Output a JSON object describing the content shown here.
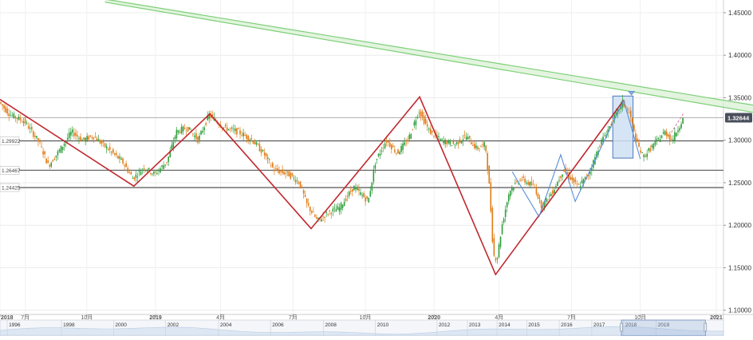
{
  "chart_data": {
    "type": "candlestick",
    "y_ticks": [
      "1.45000",
      "1.40000",
      "1.35000",
      "1.30000",
      "1.25000",
      "1.20000",
      "1.15000",
      "1.10000"
    ],
    "y_tick_values": [
      1.45,
      1.4,
      1.35,
      1.3,
      1.25,
      1.2,
      1.15,
      1.1
    ],
    "ylim": [
      1.095,
      1.465
    ],
    "x_ticks": [
      {
        "label": "2018",
        "t": 0
      },
      {
        "label": "7月",
        "t": 0.035
      },
      {
        "label": "10月",
        "t": 0.12
      },
      {
        "label": "2019",
        "t": 0.215
      },
      {
        "label": "4月",
        "t": 0.305
      },
      {
        "label": "7月",
        "t": 0.405
      },
      {
        "label": "10月",
        "t": 0.505
      },
      {
        "label": "2020",
        "t": 0.6
      },
      {
        "label": "4月",
        "t": 0.69
      },
      {
        "label": "7月",
        "t": 0.79
      },
      {
        "label": "10月",
        "t": 0.885
      },
      {
        "label": "2021",
        "t": 0.99
      }
    ],
    "current_price": {
      "label": "1.32644",
      "value": 1.32644
    },
    "horizontal_levels": [
      {
        "label": "",
        "value": 1.3264
      },
      {
        "label": "1.29922",
        "value": 1.2992
      },
      {
        "label": "1.26467",
        "value": 1.2647
      },
      {
        "label": "1.24425",
        "value": 1.2443
      }
    ],
    "resistance_channel": {
      "x0": 0.145,
      "y0_top": 1.466,
      "y0_bot": 1.4625,
      "x1": 1.0,
      "y1_top": 1.3395,
      "y1_bot": 1.331
    },
    "zigzag": [
      {
        "t": 0.0,
        "v": 1.348
      },
      {
        "t": 0.185,
        "v": 1.246
      },
      {
        "t": 0.29,
        "v": 1.331
      },
      {
        "t": 0.43,
        "v": 1.196
      },
      {
        "t": 0.58,
        "v": 1.351
      },
      {
        "t": 0.685,
        "v": 1.142
      },
      {
        "t": 0.862,
        "v": 1.347
      }
    ],
    "zigzag_blue": [
      {
        "t": 0.708,
        "v": 1.263
      },
      {
        "t": 0.745,
        "v": 1.21
      },
      {
        "t": 0.775,
        "v": 1.283
      },
      {
        "t": 0.795,
        "v": 1.228
      },
      {
        "t": 0.862,
        "v": 1.347
      },
      {
        "t": 0.885,
        "v": 1.278
      }
    ],
    "highlight_box": {
      "t0": 0.847,
      "t1": 0.875,
      "v_top": 1.352,
      "v_bottom": 1.279
    },
    "dashed_projection": {
      "t0": 0.925,
      "v0": 1.305,
      "t1": 0.945,
      "v1": 1.332
    },
    "price_path": [
      [
        0.0,
        1.345
      ],
      [
        0.015,
        1.33
      ],
      [
        0.035,
        1.322
      ],
      [
        0.055,
        1.298
      ],
      [
        0.068,
        1.27
      ],
      [
        0.085,
        1.29
      ],
      [
        0.1,
        1.31
      ],
      [
        0.115,
        1.3
      ],
      [
        0.13,
        1.305
      ],
      [
        0.15,
        1.29
      ],
      [
        0.17,
        1.275
      ],
      [
        0.185,
        1.255
      ],
      [
        0.2,
        1.268
      ],
      [
        0.215,
        1.26
      ],
      [
        0.232,
        1.275
      ],
      [
        0.245,
        1.31
      ],
      [
        0.26,
        1.315
      ],
      [
        0.275,
        1.3
      ],
      [
        0.29,
        1.33
      ],
      [
        0.31,
        1.315
      ],
      [
        0.33,
        1.31
      ],
      [
        0.35,
        1.3
      ],
      [
        0.365,
        1.285
      ],
      [
        0.38,
        1.265
      ],
      [
        0.4,
        1.26
      ],
      [
        0.415,
        1.25
      ],
      [
        0.425,
        1.225
      ],
      [
        0.44,
        1.205
      ],
      [
        0.455,
        1.215
      ],
      [
        0.47,
        1.22
      ],
      [
        0.49,
        1.245
      ],
      [
        0.51,
        1.228
      ],
      [
        0.52,
        1.275
      ],
      [
        0.535,
        1.3
      ],
      [
        0.55,
        1.285
      ],
      [
        0.565,
        1.3
      ],
      [
        0.58,
        1.335
      ],
      [
        0.595,
        1.31
      ],
      [
        0.61,
        1.3
      ],
      [
        0.63,
        1.295
      ],
      [
        0.645,
        1.305
      ],
      [
        0.66,
        1.29
      ],
      [
        0.672,
        1.295
      ],
      [
        0.678,
        1.24
      ],
      [
        0.683,
        1.165
      ],
      [
        0.688,
        1.16
      ],
      [
        0.695,
        1.2
      ],
      [
        0.705,
        1.24
      ],
      [
        0.72,
        1.255
      ],
      [
        0.74,
        1.245
      ],
      [
        0.75,
        1.222
      ],
      [
        0.765,
        1.24
      ],
      [
        0.78,
        1.265
      ],
      [
        0.8,
        1.245
      ],
      [
        0.815,
        1.26
      ],
      [
        0.83,
        1.295
      ],
      [
        0.845,
        1.318
      ],
      [
        0.862,
        1.345
      ],
      [
        0.872,
        1.33
      ],
      [
        0.88,
        1.3
      ],
      [
        0.89,
        1.28
      ],
      [
        0.905,
        1.295
      ],
      [
        0.92,
        1.31
      ],
      [
        0.93,
        1.3
      ],
      [
        0.945,
        1.325
      ]
    ],
    "navigator_labels": [
      {
        "label": "1996",
        "t": 0.01
      },
      {
        "label": "1998",
        "t": 0.085
      },
      {
        "label": "2000",
        "t": 0.157
      },
      {
        "label": "2002",
        "t": 0.229
      },
      {
        "label": "2004",
        "t": 0.302
      },
      {
        "label": "2006",
        "t": 0.374
      },
      {
        "label": "2008",
        "t": 0.447
      },
      {
        "label": "2010",
        "t": 0.519
      },
      {
        "label": "2012",
        "t": 0.604
      },
      {
        "label": "2013",
        "t": 0.646
      },
      {
        "label": "2014",
        "t": 0.687
      },
      {
        "label": "2015",
        "t": 0.728
      },
      {
        "label": "2016",
        "t": 0.773
      },
      {
        "label": "2017",
        "t": 0.818
      },
      {
        "label": "2018",
        "t": 0.862
      },
      {
        "label": "2019",
        "t": 0.907
      }
    ],
    "navigator_window": {
      "t0": 0.859,
      "t1": 0.975
    },
    "colors": {
      "bull": "#2e9e3a",
      "bear": "#e07b14",
      "zigzag": "#c0282e",
      "zigzag_blue": "#5b8fd6",
      "channel": "#7ccf76",
      "level": "#555555",
      "current_bg": "#4a4f5c",
      "highlight": "#cfe0f3",
      "highlight_stroke": "#4a78bd"
    }
  }
}
